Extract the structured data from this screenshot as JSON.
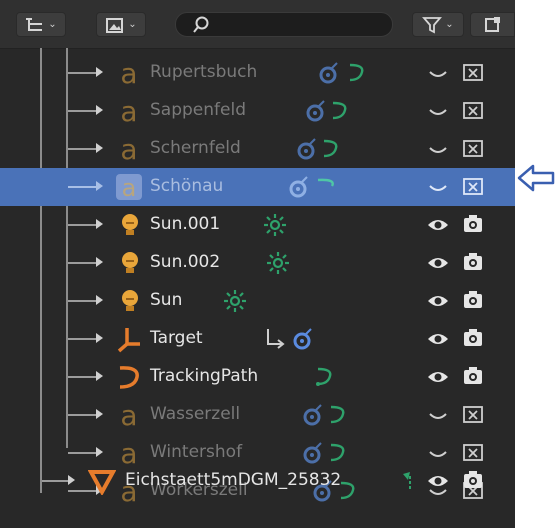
{
  "header": {
    "filter_icon": "funnel-icon",
    "search_placeholder": ""
  },
  "rows": [
    {
      "label": "Rupertsbuch",
      "type": "text-object",
      "dim": true
    },
    {
      "label": "Sappenfeld",
      "type": "text-object",
      "dim": true
    },
    {
      "label": "Schernfeld",
      "type": "text-object",
      "dim": true
    },
    {
      "label": "Schönau",
      "type": "text-object",
      "dim": true,
      "selected": true
    },
    {
      "label": "Sun.001",
      "type": "light"
    },
    {
      "label": "Sun.002",
      "type": "light"
    },
    {
      "label": "Sun",
      "type": "light"
    },
    {
      "label": "Target",
      "type": "empty"
    },
    {
      "label": "TrackingPath",
      "type": "curve"
    },
    {
      "label": "Wasserzell",
      "type": "text-object",
      "dim": true
    },
    {
      "label": "Wintershof",
      "type": "text-object",
      "dim": true
    },
    {
      "label": "Workerszell",
      "type": "text-object",
      "dim": true
    },
    {
      "label": "Eichstaett5mDGM_25832",
      "type": "mesh"
    }
  ],
  "colors": {
    "selection": "#4a72b8",
    "light_icon": "#e9a63a",
    "empty_icon": "#e67c2c",
    "constraint_green": "#2ea26b",
    "arrow": "#3a5fb0"
  }
}
